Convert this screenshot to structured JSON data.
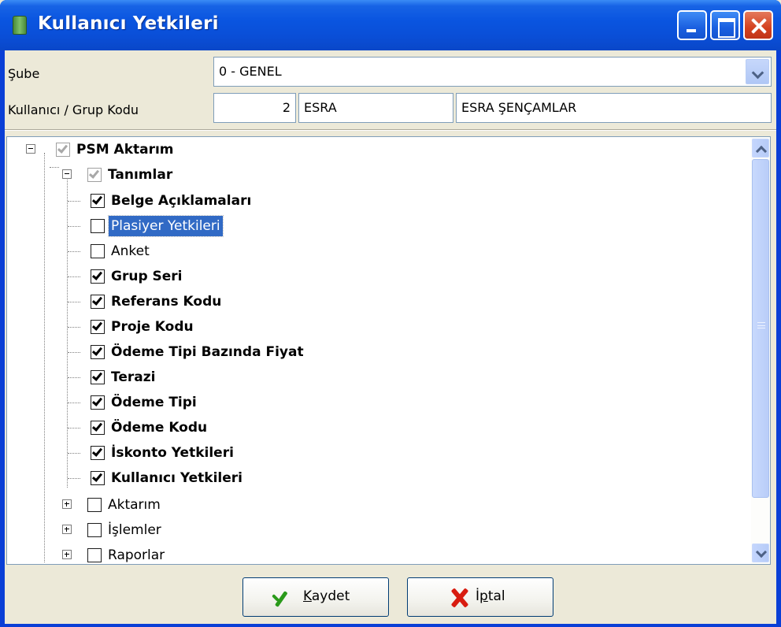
{
  "window": {
    "title": "Kullanıcı Yetkileri",
    "icon": "app-icon"
  },
  "form": {
    "sube_label": "Şube",
    "sube_value": "0 - GENEL",
    "user_label": "Kullanıcı / Grup Kodu",
    "user_code": "2",
    "user_short": "ESRA",
    "user_full": "ESRA ŞENÇAMLAR"
  },
  "tree": {
    "root": {
      "label": "PSM Aktarım",
      "checked": "partial"
    },
    "tanimlar": {
      "label": "Tanımlar",
      "checked": "partial"
    },
    "items": [
      {
        "label": "Belge Açıklamaları",
        "checked": true
      },
      {
        "label": "Plasiyer Yetkileri",
        "checked": false,
        "selected": true
      },
      {
        "label": "Anket",
        "checked": false
      },
      {
        "label": "Grup Seri",
        "checked": true
      },
      {
        "label": "Referans Kodu",
        "checked": true
      },
      {
        "label": "Proje Kodu",
        "checked": true
      },
      {
        "label": "Ödeme Tipi Bazında Fiyat",
        "checked": true
      },
      {
        "label": "Terazi",
        "checked": true
      },
      {
        "label": "Ödeme Tipi",
        "checked": true
      },
      {
        "label": "Ödeme Kodu",
        "checked": true
      },
      {
        "label": "İskonto Yetkileri",
        "checked": true
      },
      {
        "label": "Kullanıcı Yetkileri",
        "checked": true
      }
    ],
    "groups": [
      {
        "label": "Aktarım",
        "checked": false
      },
      {
        "label": "İşlemler",
        "checked": false
      },
      {
        "label": "Raporlar",
        "checked": false
      }
    ]
  },
  "buttons": {
    "save_label_u": "K",
    "save_label_rest": "aydet",
    "cancel_label_a": "İ",
    "cancel_label_u": "p",
    "cancel_label_rest": "tal"
  }
}
